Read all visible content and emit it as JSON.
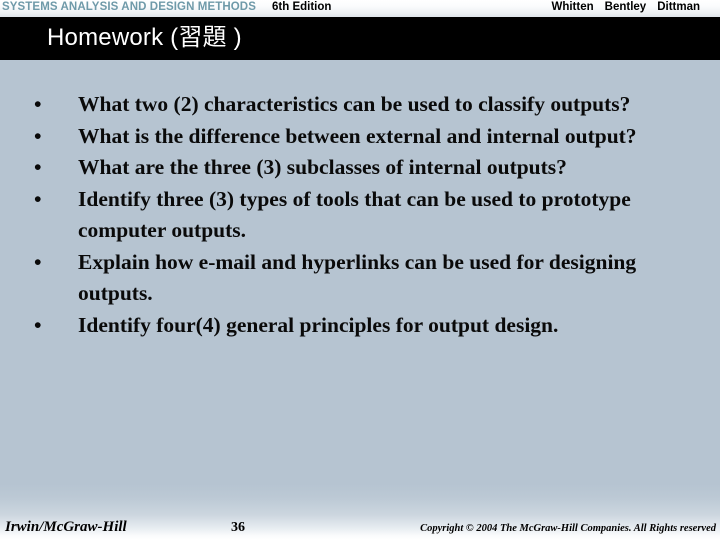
{
  "header": {
    "book_title": "SYSTEMS ANALYSIS AND DESIGN METHODS",
    "book_title_color": "#6f9aa9",
    "edition": "6th Edition",
    "authors": [
      "Whitten",
      "Bentley",
      "Dittman"
    ]
  },
  "slide": {
    "title": "Homework (習題 )",
    "title_banner_color": "#000000",
    "title_text_color": "#ffffff",
    "background_color": "#b6c4d1",
    "bullet_marker": "•",
    "bullets": [
      "What two (2) characteristics can be used to classify outputs?",
      "What is the difference between external and internal output?",
      "What are the three (3) subclasses of internal outputs?",
      "Identify three (3) types of tools that can be used to prototype computer outputs.",
      "Explain how e-mail and hyperlinks can be used for designing outputs.",
      "Identify four(4) general principles for output design."
    ]
  },
  "footer": {
    "publisher": "Irwin/McGraw-Hill",
    "page_number": "36",
    "copyright": "Copyright © 2004 The McGraw-Hill Companies. All Rights reserved"
  }
}
